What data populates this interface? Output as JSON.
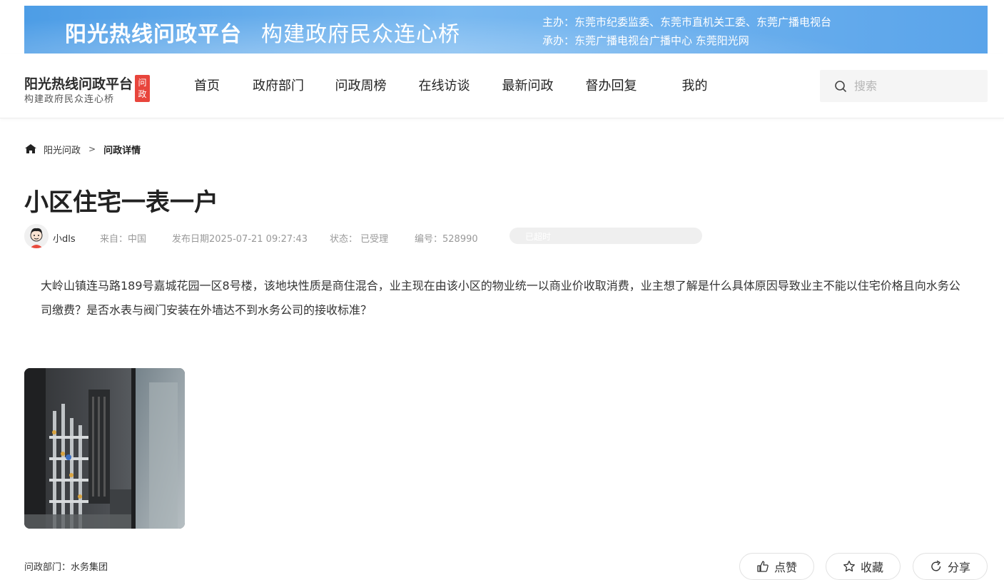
{
  "banner": {
    "title": "阳光热线问政平台",
    "slogan": "构建政府民众连心桥",
    "host": "主办：东莞市纪委监委、东莞市直机关工委、东莞广播电视台",
    "organizer": "承办：东莞广播电视台广播中心 东莞阳光网"
  },
  "logo": {
    "name": "阳光热线问政平台",
    "slogan": "构建政府民众连心桥",
    "stamp_line1": "问",
    "stamp_line2": "政"
  },
  "nav": {
    "items": [
      {
        "label": "首页"
      },
      {
        "label": "政府部门"
      },
      {
        "label": "问政周榜"
      },
      {
        "label": "在线访谈"
      },
      {
        "label": "最新问政"
      },
      {
        "label": "督办回复"
      },
      {
        "label": "我的"
      }
    ]
  },
  "search": {
    "placeholder": "搜索",
    "icon": "search-icon"
  },
  "breadcrumb": {
    "home_icon": "home-icon",
    "home": "阳光问政",
    "separator": ">",
    "current": "问政详情"
  },
  "post": {
    "title": "小区住宅一表一户",
    "author": "小dls",
    "source": "来自：中国",
    "date": "发布日期2025-07-21 09:27:43",
    "status": "状态： 已受理",
    "number": "编号：528990",
    "badge": "已超时",
    "content": "大岭山镇连马路189号嘉城花园一区8号楼，该地块性质是商住混合，业主现在由该小区的物业统一以商业价收取消费，业主想了解是什么具体原因导致业主不能以住宅价格且向水务公司缴费？是否水表与阀门安装在外墙达不到水务公司的接收标准？",
    "department": "问政部门：水务集团"
  },
  "actions": {
    "like": "点赞",
    "favorite": "收藏",
    "share": "分享"
  },
  "colors": {
    "banner_blue": "#5aa4ea",
    "stamp_red": "#e8453c",
    "badge_bg": "#efefef"
  }
}
